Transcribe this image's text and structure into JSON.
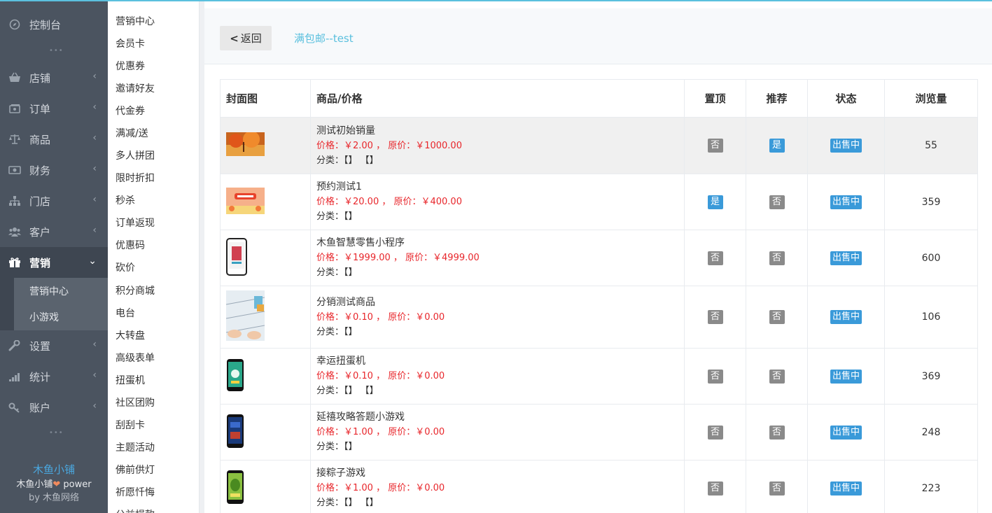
{
  "sidebar": {
    "dashboard": "控制台",
    "items": [
      {
        "label": "店铺",
        "icon": "basket-icon"
      },
      {
        "label": "订单",
        "icon": "order-icon"
      },
      {
        "label": "商品",
        "icon": "scale-icon"
      },
      {
        "label": "财务",
        "icon": "money-icon"
      },
      {
        "label": "门店",
        "icon": "sitemap-icon"
      },
      {
        "label": "客户",
        "icon": "users-icon"
      },
      {
        "label": "营销",
        "icon": "gift-icon"
      },
      {
        "label": "设置",
        "icon": "wrench-icon"
      },
      {
        "label": "统计",
        "icon": "signal-icon"
      },
      {
        "label": "账户",
        "icon": "key-icon"
      }
    ],
    "submenu": [
      "营销中心",
      "小游戏"
    ],
    "footer_brand": "木鱼小铺",
    "footer_power_left": "木鱼小铺",
    "footer_power_right": " power",
    "footer_by_left": "by ",
    "footer_by_right": "木鱼网络"
  },
  "menu2": [
    "营销中心",
    "会员卡",
    "优惠券",
    "邀请好友",
    "代金券",
    "满减/送",
    "多人拼团",
    "限时折扣",
    "秒杀",
    "订单返现",
    "优惠码",
    "砍价",
    "积分商城",
    "电台",
    "大转盘",
    "高级表单",
    "扭蛋机",
    "社区团购",
    "刮刮卡",
    "主题活动",
    "佛前供灯",
    "祈愿忏悔",
    "公益捐款"
  ],
  "header": {
    "back_label": "返回",
    "title": "满包邮--test"
  },
  "table": {
    "columns": [
      "封面图",
      "商品/价格",
      "置顶",
      "推荐",
      "状态",
      "浏览量"
    ],
    "rows": [
      {
        "name": "测试初始销量",
        "price": "价格：￥2.00 ， 原价：￥1000.00",
        "category": "分类：【】 【】",
        "top": "否",
        "rec": "是",
        "status": "出售中",
        "views": "55"
      },
      {
        "name": "预约测试1",
        "price": "价格：￥20.00 ， 原价：￥400.00",
        "category": "分类：【】",
        "top": "是",
        "rec": "否",
        "status": "出售中",
        "views": "359"
      },
      {
        "name": "木鱼智慧零售小程序",
        "price": "价格：￥1999.00 ， 原价：￥4999.00",
        "category": "分类：【】",
        "top": "否",
        "rec": "否",
        "status": "出售中",
        "views": "600"
      },
      {
        "name": "分销测试商品",
        "price": "价格：￥0.10 ， 原价：￥0.00",
        "category": "分类：【】",
        "top": "否",
        "rec": "否",
        "status": "出售中",
        "views": "106"
      },
      {
        "name": "幸运扭蛋机",
        "price": "价格：￥0.10 ， 原价：￥0.00",
        "category": "分类：【】 【】",
        "top": "否",
        "rec": "否",
        "status": "出售中",
        "views": "369"
      },
      {
        "name": "延禧攻略答题小游戏",
        "price": "价格：￥1.00 ， 原价：￥0.00",
        "category": "分类：【】",
        "top": "否",
        "rec": "否",
        "status": "出售中",
        "views": "248"
      },
      {
        "name": "接粽子游戏",
        "price": "价格：￥1.00 ， 原价：￥0.00",
        "category": "分类：【】 【】",
        "top": "否",
        "rec": "否",
        "status": "出售中",
        "views": "223"
      }
    ]
  },
  "colors": {
    "accent": "#5bc0de",
    "sidebar": "#4b5460",
    "badge_gray": "#8a8a8a",
    "badge_blue": "#3a9ad9",
    "price": "#e8262b"
  }
}
